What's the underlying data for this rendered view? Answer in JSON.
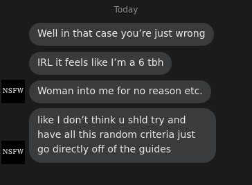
{
  "conversation": {
    "date_separator": "Today",
    "messages": [
      {
        "text": "Well in that case you’re just wrong"
      },
      {
        "text": "IRL it feels like I’m a 6 tbh"
      },
      {
        "text": "Woman into me for no reason etc.",
        "avatar": "NSFW"
      },
      {
        "text": "like I don’t think u shld try and have all this random criteria just go directly off of the guides",
        "avatar": "NSFW"
      }
    ]
  },
  "colors": {
    "background": "#1b1b1c",
    "bubble": "#3a3b3d",
    "text": "#e6e6e6",
    "date_text": "#8b8b8e",
    "avatar_bg": "#000000"
  }
}
